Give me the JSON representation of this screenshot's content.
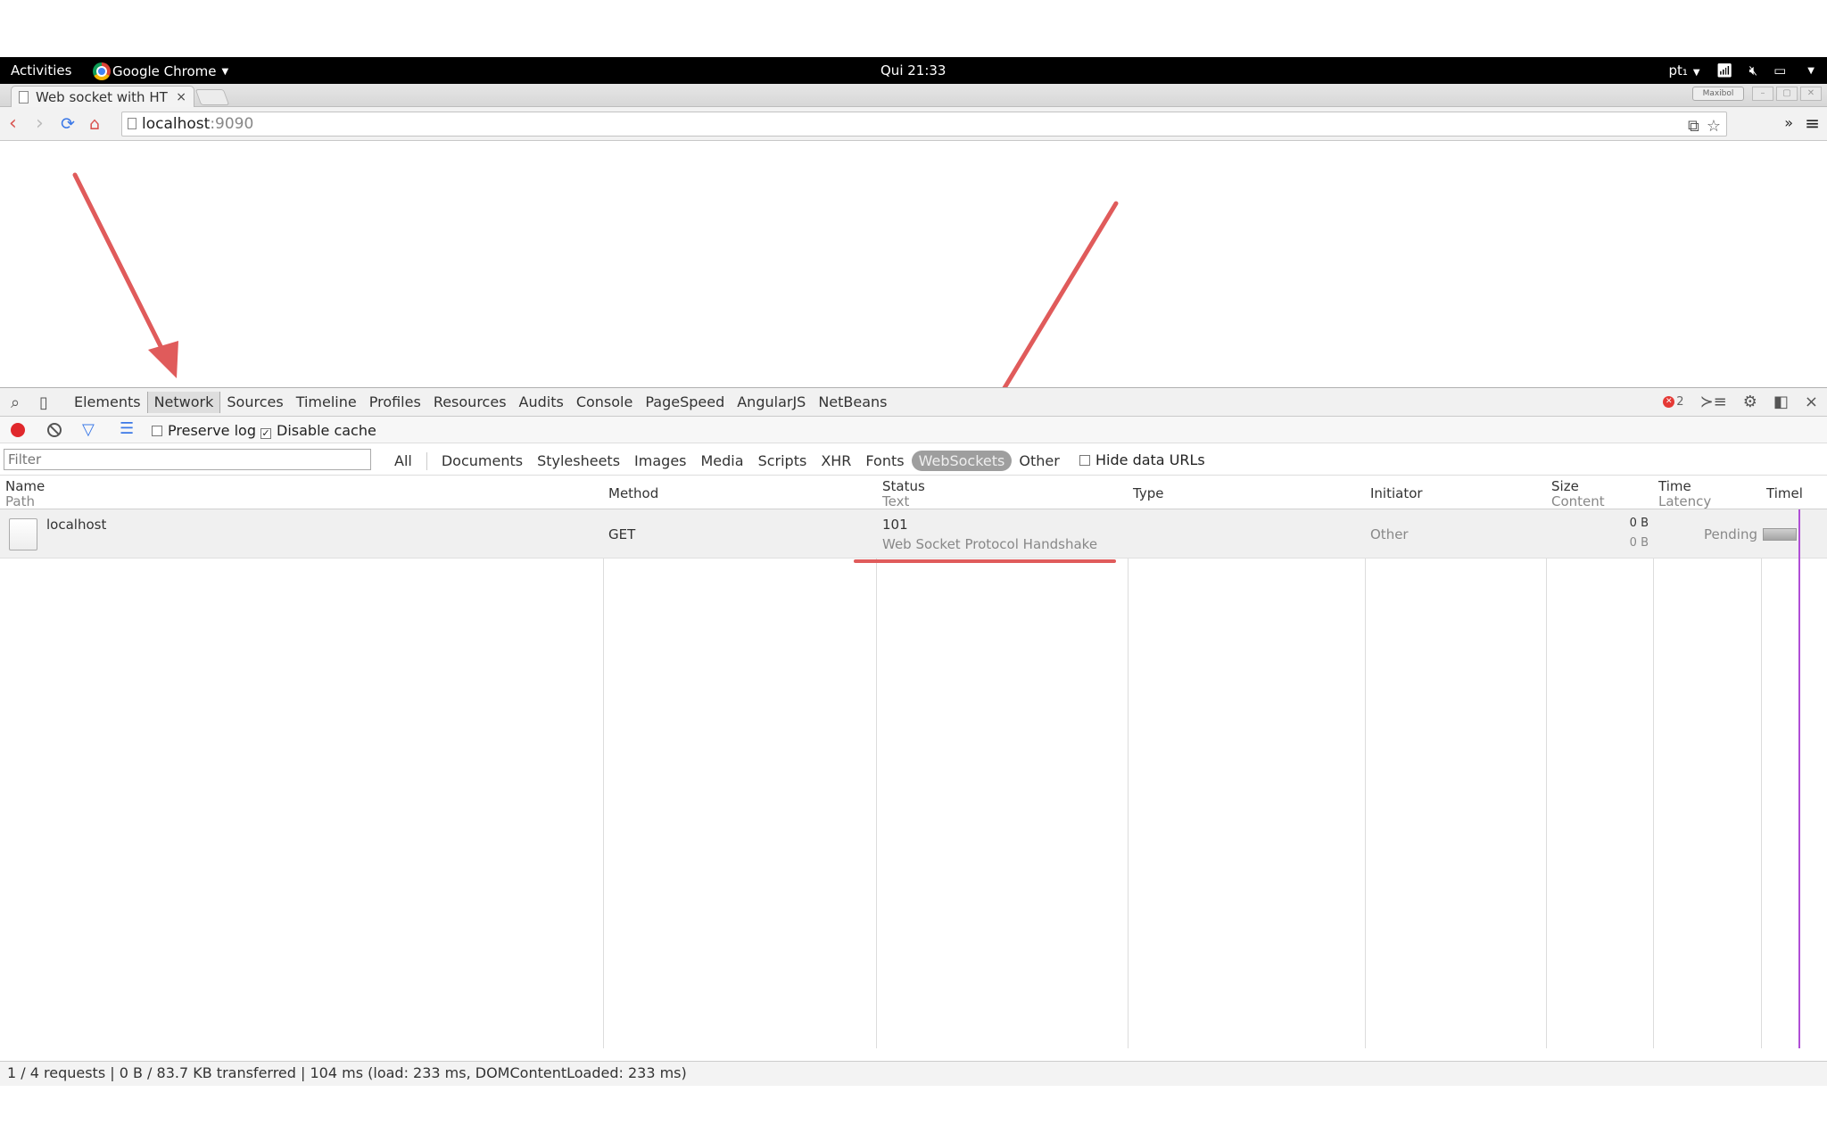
{
  "topbar": {
    "activities": "Activities",
    "app_name": "Google Chrome",
    "clock": "Qui 21:33",
    "lang": "pt₁"
  },
  "browser": {
    "tab_title": "Web socket with HT",
    "tab_close": "×",
    "profile": "Maxibol",
    "url_host": "localhost",
    "url_port": ":9090",
    "extensions_overflow": "»"
  },
  "devtools": {
    "tabs": [
      {
        "label": "Elements"
      },
      {
        "label": "Network"
      },
      {
        "label": "Sources"
      },
      {
        "label": "Timeline"
      },
      {
        "label": "Profiles"
      },
      {
        "label": "Resources"
      },
      {
        "label": "Audits"
      },
      {
        "label": "Console"
      },
      {
        "label": "PageSpeed"
      },
      {
        "label": "AngularJS"
      },
      {
        "label": "NetBeans"
      }
    ],
    "active_tab": "Network",
    "error_count": "2",
    "close": "×"
  },
  "network": {
    "preserve_log": "Preserve log",
    "preserve_log_checked": false,
    "disable_cache": "Disable cache",
    "disable_cache_checked": true,
    "filter_placeholder": "Filter",
    "types": [
      "All",
      "Documents",
      "Stylesheets",
      "Images",
      "Media",
      "Scripts",
      "XHR",
      "Fonts",
      "WebSockets",
      "Other"
    ],
    "active_type": "WebSockets",
    "hide_data_urls": "Hide data URLs",
    "columns": {
      "name": "Name",
      "name_sub": "Path",
      "method": "Method",
      "status": "Status",
      "status_sub": "Text",
      "type": "Type",
      "initiator": "Initiator",
      "size": "Size",
      "size_sub": "Content",
      "time": "Time",
      "time_sub": "Latency",
      "timeline": "Timel"
    },
    "rows": [
      {
        "name": "localhost",
        "method": "GET",
        "status": "101",
        "status_text": "Web Socket Protocol Handshake",
        "type": "",
        "initiator": "Other",
        "size": "0 B",
        "content": "0 B",
        "time": "Pending"
      }
    ],
    "summary": "1 / 4 requests  |  0 B / 83.7 KB transferred  |  104 ms (load: 233 ms, DOMContentLoaded: 233 ms)"
  },
  "colors": {
    "arrow": "#e05b5b",
    "record": "#e0282c",
    "timeline_marker": "#b04fd6"
  }
}
